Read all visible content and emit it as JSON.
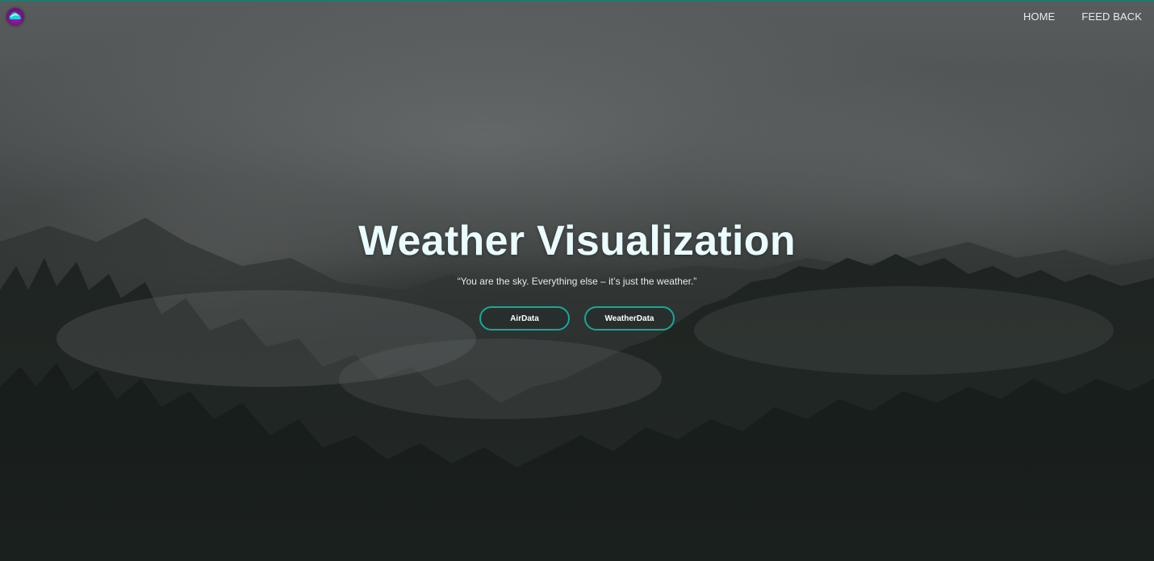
{
  "nav": {
    "logo_name": "cloud-logo-icon",
    "links": [
      {
        "label": "HOME"
      },
      {
        "label": "FEED BACK"
      }
    ]
  },
  "hero": {
    "title": "Weather Visualization",
    "quote": "“You are the sky. Everything else – it’s just the weather.”",
    "buttons": [
      {
        "label": "AirData"
      },
      {
        "label": "WeatherData"
      }
    ]
  },
  "colors": {
    "accent": "#18a898",
    "logo": "#9a1fa6",
    "title": "#eafcff"
  }
}
